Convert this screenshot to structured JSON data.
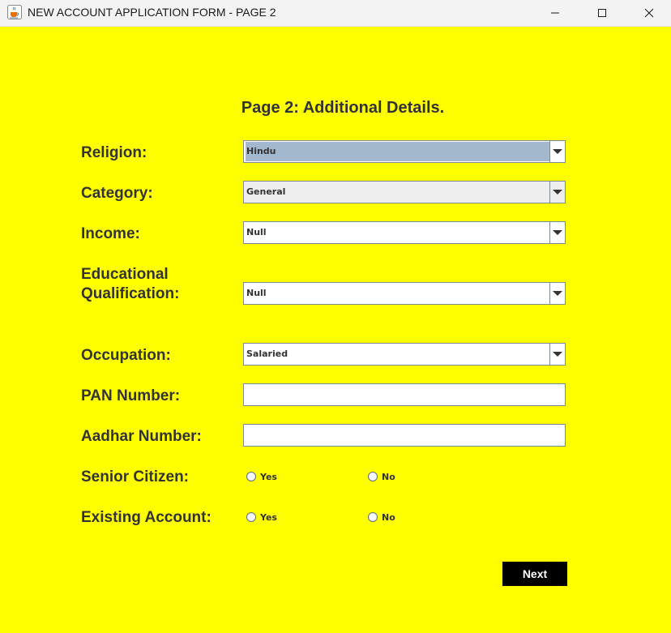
{
  "window": {
    "title": "NEW ACCOUNT APPLICATION FORM - PAGE 2",
    "app_icon": "java-cup-icon",
    "controls": [
      "minimize-icon",
      "maximize-icon",
      "close-icon"
    ]
  },
  "form": {
    "heading": "Page 2: Additional Details.",
    "religion": {
      "label": "Religion:",
      "value": "Hindu"
    },
    "category": {
      "label": "Category:",
      "value": "General"
    },
    "income": {
      "label": "Income:",
      "value": "Null"
    },
    "education": {
      "label_line1": "Educational",
      "label_line2": "Qualification:",
      "value": "Null"
    },
    "occupation": {
      "label": "Occupation:",
      "value": "Salaried"
    },
    "pan": {
      "label": "PAN Number:",
      "value": ""
    },
    "aadhar": {
      "label": "Aadhar Number:",
      "value": ""
    },
    "senior_citizen": {
      "label": "Senior Citizen:",
      "yes": "Yes",
      "no": "No",
      "selected": null
    },
    "existing_account": {
      "label": "Existing Account:",
      "yes": "Yes",
      "no": "No",
      "selected": null
    },
    "next_label": "Next"
  },
  "colors": {
    "background": "#ffff00",
    "label_text": "#333333",
    "selected_combo": "#a3b8cc",
    "button": "#000000",
    "button_text": "#ffffff"
  }
}
